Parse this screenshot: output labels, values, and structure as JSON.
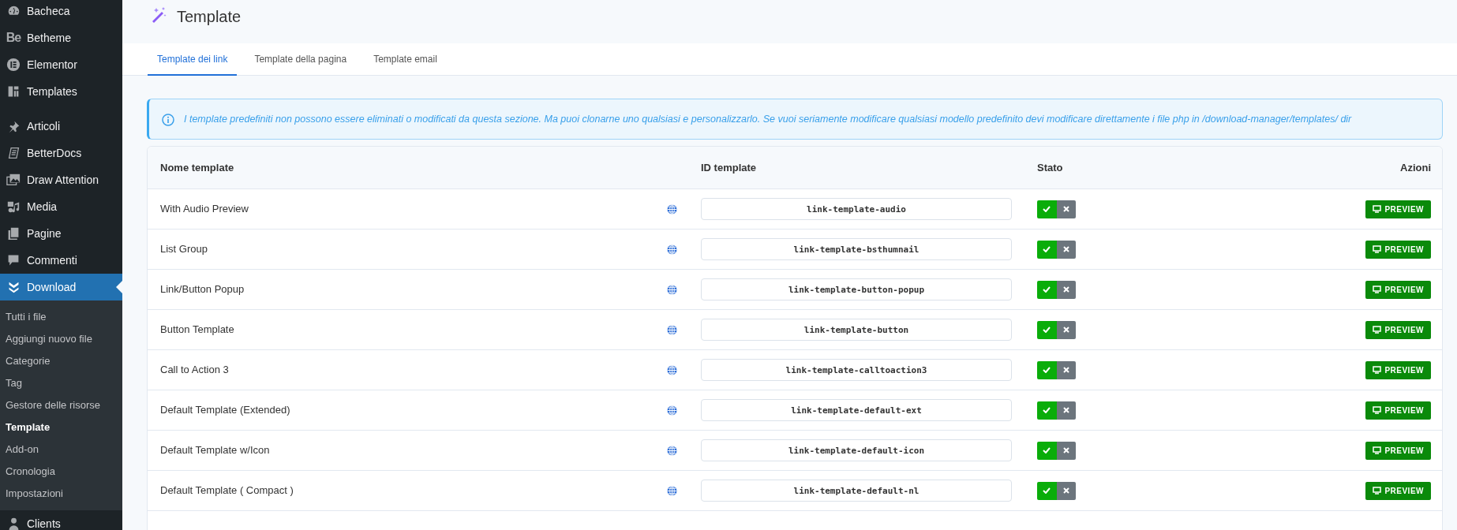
{
  "sidebar": {
    "items": [
      {
        "label": "Bacheca",
        "current": false
      },
      {
        "label": "Betheme",
        "current": false,
        "logo_text": "Be"
      },
      {
        "label": "Elementor",
        "current": false
      },
      {
        "label": "Templates",
        "current": false
      },
      {
        "label": "Articoli",
        "current": false,
        "gap_before": true
      },
      {
        "label": "BetterDocs",
        "current": false
      },
      {
        "label": "Draw Attention",
        "current": false
      },
      {
        "label": "Media",
        "current": false
      },
      {
        "label": "Pagine",
        "current": false
      },
      {
        "label": "Commenti",
        "current": false
      },
      {
        "label": "Download",
        "current": true,
        "submenu": [
          {
            "label": "Tutti i file",
            "selected": false
          },
          {
            "label": "Aggiungi nuovo file",
            "selected": false
          },
          {
            "label": "Categorie",
            "selected": false
          },
          {
            "label": "Tag",
            "selected": false
          },
          {
            "label": "Gestore delle risorse",
            "selected": false
          },
          {
            "label": "Template",
            "selected": true
          },
          {
            "label": "Add-on",
            "selected": false
          },
          {
            "label": "Cronologia",
            "selected": false
          },
          {
            "label": "Impostazioni",
            "selected": false
          }
        ]
      },
      {
        "label": "Clients",
        "current": false
      }
    ]
  },
  "page_title": "Template",
  "tabs": [
    {
      "label": "Template dei link",
      "selected": true
    },
    {
      "label": "Template della pagina",
      "selected": false
    },
    {
      "label": "Template email",
      "selected": false
    }
  ],
  "notice": "I template predefiniti non possono essere eliminati o modificati da questa sezione. Ma puoi clonarne uno qualsiasi e personalizzarlo. Se vuoi seriamente modificare qualsiasi modello predefinito devi modificare direttamente i file php in /download-manager/templates/ dir",
  "table": {
    "columns": [
      "Nome template",
      "ID template",
      "Stato",
      "Azioni"
    ],
    "rows": [
      {
        "name": "With Audio Preview",
        "id": "link-template-audio",
        "enabled": true,
        "action": "PREVIEW"
      },
      {
        "name": "List Group",
        "id": "link-template-bsthumnail",
        "enabled": true,
        "action": "PREVIEW"
      },
      {
        "name": "Link/Button Popup",
        "id": "link-template-button-popup",
        "enabled": true,
        "action": "PREVIEW"
      },
      {
        "name": "Button Template",
        "id": "link-template-button",
        "enabled": true,
        "action": "PREVIEW"
      },
      {
        "name": "Call to Action 3",
        "id": "link-template-calltoaction3",
        "enabled": true,
        "action": "PREVIEW"
      },
      {
        "name": "Default Template (Extended)",
        "id": "link-template-default-ext",
        "enabled": true,
        "action": "PREVIEW"
      },
      {
        "name": "Default Template w/Icon",
        "id": "link-template-default-icon",
        "enabled": true,
        "action": "PREVIEW"
      },
      {
        "name": "Default Template ( Compact )",
        "id": "link-template-default-nl",
        "enabled": true,
        "action": "PREVIEW"
      }
    ]
  }
}
